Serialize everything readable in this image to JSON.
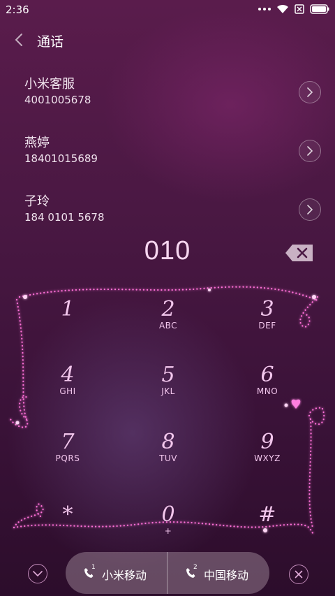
{
  "status_bar": {
    "time": "2:36"
  },
  "header": {
    "title": "通话"
  },
  "contacts": [
    {
      "name": "小米客服",
      "number": "4001005678"
    },
    {
      "name": "燕婷",
      "number": "18401015689"
    },
    {
      "name": "子玲",
      "number": "184 0101 5678"
    }
  ],
  "dialer": {
    "input": "010",
    "keys": [
      {
        "digit": "1",
        "letters": ""
      },
      {
        "digit": "2",
        "letters": "ABC"
      },
      {
        "digit": "3",
        "letters": "DEF"
      },
      {
        "digit": "4",
        "letters": "GHI"
      },
      {
        "digit": "5",
        "letters": "JKL"
      },
      {
        "digit": "6",
        "letters": "MNO"
      },
      {
        "digit": "7",
        "letters": "PQRS"
      },
      {
        "digit": "8",
        "letters": "TUV"
      },
      {
        "digit": "9",
        "letters": "WXYZ"
      },
      {
        "digit": "*",
        "letters": ""
      },
      {
        "digit": "0",
        "letters": "+"
      },
      {
        "digit": "#",
        "letters": ""
      }
    ]
  },
  "bottom_bar": {
    "sim1": {
      "slot": "1",
      "label": "小米移动"
    },
    "sim2": {
      "slot": "2",
      "label": "中国移动"
    }
  },
  "icons": {
    "status": [
      "more-dots-icon",
      "wifi-icon",
      "no-sim-icon",
      "battery-icon"
    ],
    "back": "chevron-left-icon",
    "contact_detail": "chevron-right-icon",
    "backspace": "backspace-icon",
    "collapse": "chevron-down-icon",
    "close": "close-icon",
    "sim_call": "phone-icon"
  },
  "colors": {
    "accent_pink": "#f2c6ec",
    "sparkle": "#ff5fd6",
    "background": "#4a1843"
  }
}
